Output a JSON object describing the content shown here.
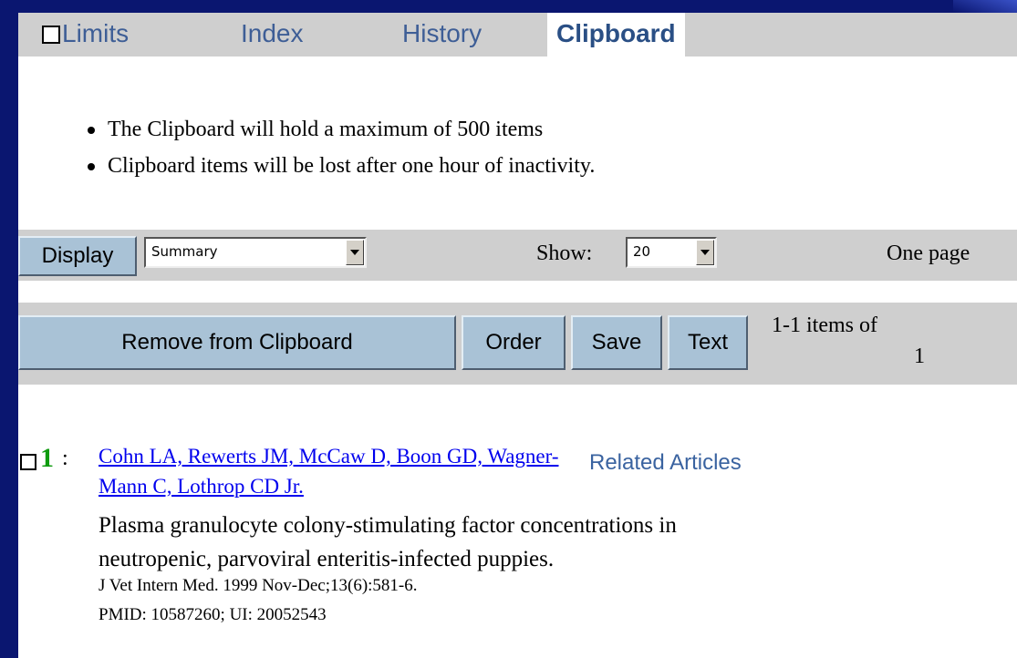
{
  "tabs": {
    "limits": "Limits",
    "index": "Index",
    "history": "History",
    "clipboard": "Clipboard"
  },
  "notes": [
    "The Clipboard will hold a maximum of 500 items",
    "Clipboard items will be lost after one hour of inactivity."
  ],
  "toolbar": {
    "display_button": "Display",
    "format_selected": "Summary",
    "show_label": "Show:",
    "show_selected": "20",
    "pages": "One page"
  },
  "actions": {
    "remove": "Remove from Clipboard",
    "order": "Order",
    "save": "Save",
    "text": "Text",
    "items_count_line1": "1-1 items of",
    "items_count_line2": "1"
  },
  "result": {
    "number": "1",
    "colon": ":",
    "authors": "Cohn LA, Rewerts JM, McCaw D, Boon GD, Wagner-Mann C, Lothrop CD Jr.",
    "related": "Related Articles",
    "title_line1": "Plasma granulocyte colony-stimulating factor concentrations in",
    "title_line2": "neutropenic, parvoviral enteritis-infected puppies.",
    "journal": "J Vet Intern Med. 1999 Nov-Dec;13(6):581-6.",
    "ids": "PMID: 10587260; UI: 20052543"
  },
  "colors": {
    "slide_background": "#0a1670",
    "tab_text": "#3e5e96",
    "button_face": "#a9c2d6",
    "link": "#0000ee",
    "result_number": "#0f9b0f"
  }
}
